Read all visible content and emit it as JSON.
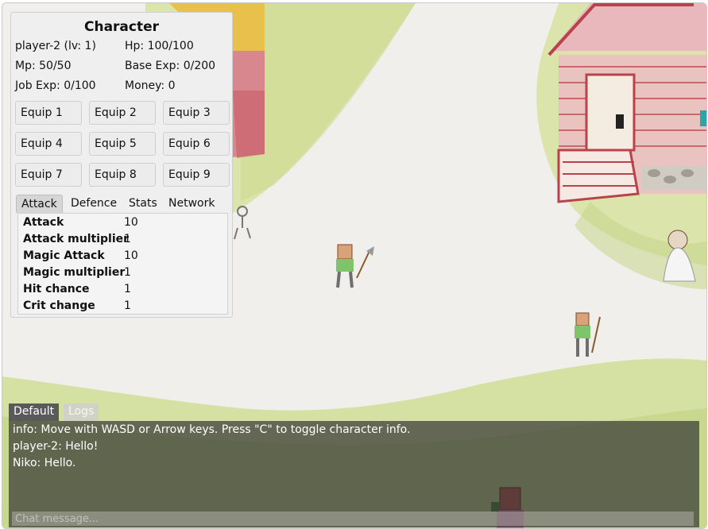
{
  "character": {
    "title": "Character",
    "name_level": "player-2 (lv: 1)",
    "hp": "Hp: 100/100",
    "mp": "Mp: 50/50",
    "base_exp": "Base Exp: 0/200",
    "job_exp": "Job Exp: 0/100",
    "money": "Money: 0",
    "equip_slots": [
      "Equip 1",
      "Equip 2",
      "Equip 3",
      "Equip 4",
      "Equip 5",
      "Equip 6",
      "Equip 7",
      "Equip 8",
      "Equip 9"
    ],
    "tabs": [
      "Attack",
      "Defence",
      "Stats",
      "Network"
    ],
    "active_tab": "Attack",
    "attack_stats": [
      {
        "label": "Attack",
        "value": "10"
      },
      {
        "label": "Attack multiplier",
        "value": "1"
      },
      {
        "label": "Magic Attack",
        "value": "10"
      },
      {
        "label": "Magic multiplier",
        "value": "1"
      },
      {
        "label": "Hit chance",
        "value": "1"
      },
      {
        "label": "Crit change",
        "value": "1"
      }
    ]
  },
  "chat": {
    "tabs": [
      "Default",
      "Logs"
    ],
    "active_tab": "Default",
    "messages": [
      "info: Move with WASD or Arrow keys. Press \"C\" to toggle character info.",
      "player-2: Hello!",
      "Niko: Hello."
    ],
    "input_placeholder": "Chat message..."
  },
  "colors": {
    "grass": "#d3df9c",
    "road": "#f1efec",
    "house_red": "#b8434a",
    "panel_bg": "#efefef",
    "chat_bg": "#2d2d2d"
  }
}
